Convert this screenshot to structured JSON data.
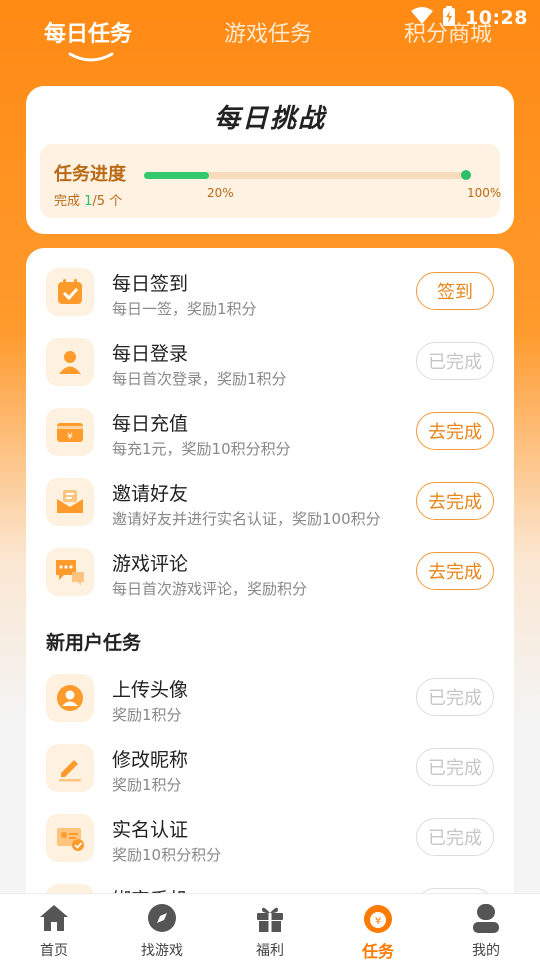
{
  "status": {
    "time": "10:28"
  },
  "header": {
    "tabs": [
      {
        "label": "每日任务",
        "active": true
      },
      {
        "label": "游戏任务",
        "active": false
      },
      {
        "label": "积分商城",
        "active": false
      }
    ]
  },
  "challenge": {
    "title": "每日挑战",
    "progress_label": "任务进度",
    "completed_prefix": "完成 ",
    "completed_count": "1",
    "completed_suffix": "/5 个",
    "progress_fraction": 0.2,
    "tick_mid": "20%",
    "tick_end": "100%"
  },
  "daily_tasks": [
    {
      "title": "每日签到",
      "desc": "每日一签，奖励1积分",
      "button": "签到",
      "done": false,
      "icon": "calendar-check-icon"
    },
    {
      "title": "每日登录",
      "desc": "每日首次登录，奖励1积分",
      "button": "已完成",
      "done": true,
      "icon": "user-icon"
    },
    {
      "title": "每日充值",
      "desc": "每充1元，奖励10积分积分",
      "button": "去完成",
      "done": false,
      "icon": "wallet-icon"
    },
    {
      "title": "邀请好友",
      "desc": "邀请好友并进行实名认证，奖励100积分",
      "button": "去完成",
      "done": false,
      "icon": "envelope-icon"
    },
    {
      "title": "游戏评论",
      "desc": "每日首次游戏评论，奖励积分",
      "button": "去完成",
      "done": false,
      "icon": "comment-icon"
    }
  ],
  "new_user_section": "新用户任务",
  "new_user_tasks": [
    {
      "title": "上传头像",
      "desc": "奖励1积分",
      "button": "已完成",
      "done": true,
      "icon": "avatar-icon"
    },
    {
      "title": "修改昵称",
      "desc": "奖励1积分",
      "button": "已完成",
      "done": true,
      "icon": "pencil-icon"
    },
    {
      "title": "实名认证",
      "desc": "奖励10积分积分",
      "button": "已完成",
      "done": true,
      "icon": "id-card-icon"
    },
    {
      "title": "绑定手机",
      "desc": "",
      "button": "",
      "done": true,
      "icon": "phone-icon"
    }
  ],
  "nav": [
    {
      "label": "首页",
      "icon": "home-icon",
      "active": false
    },
    {
      "label": "找游戏",
      "icon": "compass-icon",
      "active": false
    },
    {
      "label": "福利",
      "icon": "gift-icon",
      "active": false
    },
    {
      "label": "任务",
      "icon": "task-coin-icon",
      "active": true
    },
    {
      "label": "我的",
      "icon": "profile-icon",
      "active": false
    }
  ],
  "colors": {
    "accent": "#ff8a14",
    "progress": "#34c96e",
    "button": "#e8861c",
    "disabled": "#c6c6c6"
  }
}
